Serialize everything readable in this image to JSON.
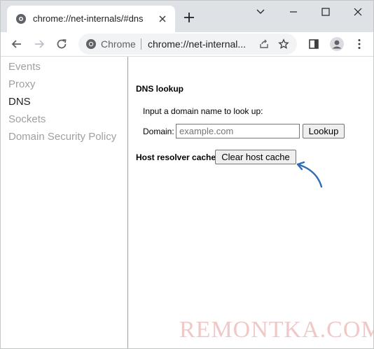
{
  "tab": {
    "title": "chrome://net-internals/#dns"
  },
  "omnibox": {
    "chip": "Chrome",
    "url": "chrome://net-internal..."
  },
  "sidebar": {
    "items": [
      {
        "label": "Events",
        "active": false
      },
      {
        "label": "Proxy",
        "active": false
      },
      {
        "label": "DNS",
        "active": true
      },
      {
        "label": "Sockets",
        "active": false
      },
      {
        "label": "Domain Security Policy",
        "active": false
      }
    ]
  },
  "dns": {
    "heading": "DNS lookup",
    "prompt": "Input a domain name to look up:",
    "domain_label": "Domain:",
    "domain_value": "",
    "domain_placeholder": "example.com",
    "lookup_label": "Lookup",
    "host_resolver_label": "Host resolver cache",
    "clear_label": "Clear host cache"
  },
  "watermark": "REMONTKA.COM",
  "colors": {
    "accent_arrow": "#2e6db5",
    "sidebar_inactive": "#a0a0a0",
    "tabstrip": "#dee1e6"
  }
}
